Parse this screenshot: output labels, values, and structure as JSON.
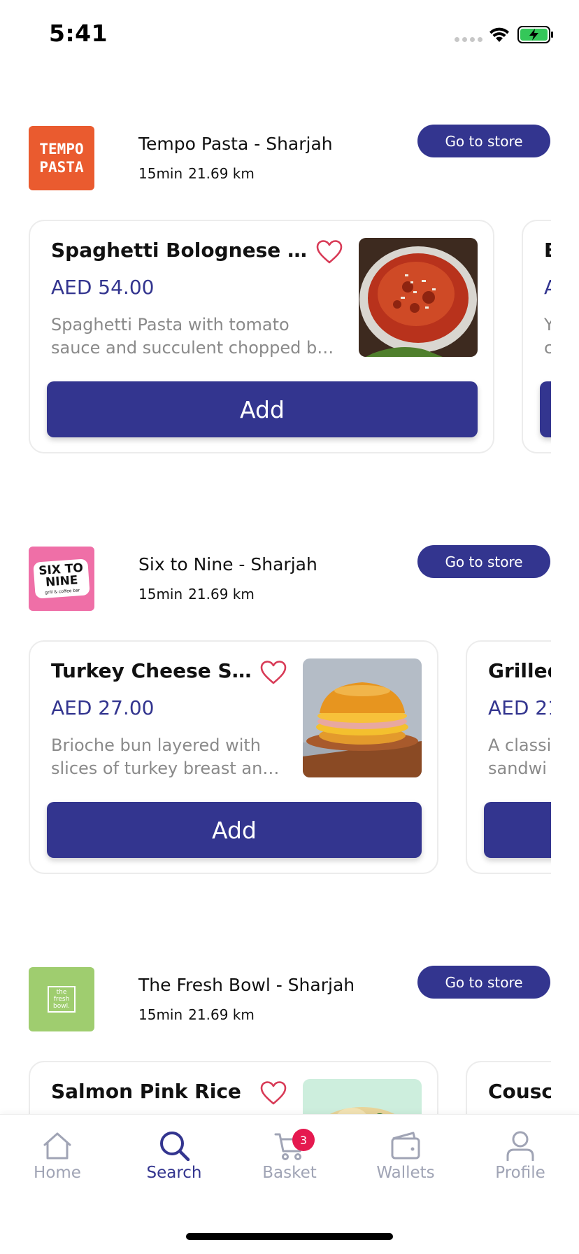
{
  "status": {
    "time": "5:41"
  },
  "stores": [
    {
      "logo_text": [
        "TEMPO",
        "PASTA"
      ],
      "name": "Tempo Pasta - Sharjah",
      "time": "15min",
      "distance": "21.69 km",
      "go_label": "Go to store",
      "products": [
        {
          "name": "Spaghetti Bolognese Pasta",
          "price": "AED 54.00",
          "desc_lines": [
            "Spaghetti Pasta with tomato",
            "sauce and succulent chopped beef"
          ],
          "add_label": "Add"
        },
        {
          "name": "B",
          "price": "A",
          "desc_lines": [
            "Y",
            "c"
          ],
          "add_label": ""
        }
      ]
    },
    {
      "logo_text": [
        "SIX TO",
        "NINE",
        "grill & coffee bar"
      ],
      "name": "Six to Nine - Sharjah",
      "time": "15min",
      "distance": "21.69 km",
      "go_label": "Go to store",
      "products": [
        {
          "name": "Turkey Cheese Sandwich",
          "price": "AED 27.00",
          "desc_lines": [
            "Brioche bun layered with",
            "slices of turkey breast and cheese"
          ],
          "add_label": "Add"
        },
        {
          "name": "Grilled",
          "price": "AED 21.",
          "desc_lines": [
            "A classi",
            "sandwi"
          ],
          "add_label": ""
        }
      ]
    },
    {
      "logo_text": [
        "the",
        "fresh",
        "bowl."
      ],
      "name": "The Fresh Bowl - Sharjah",
      "time": "15min",
      "distance": "21.69 km",
      "go_label": "Go to store",
      "products": [
        {
          "name": "Salmon Pink Rice",
          "price": "",
          "desc_lines": [],
          "add_label": ""
        },
        {
          "name": "Cousc",
          "price": "",
          "desc_lines": [],
          "add_label": ""
        }
      ]
    }
  ],
  "tabs": [
    {
      "label": "Home",
      "icon": "home-icon",
      "active": false
    },
    {
      "label": "Search",
      "icon": "search-icon",
      "active": true
    },
    {
      "label": "Basket",
      "icon": "cart-icon",
      "active": false,
      "badge": "3"
    },
    {
      "label": "Wallets",
      "icon": "wallet-icon",
      "active": false
    },
    {
      "label": "Profile",
      "icon": "profile-icon",
      "active": false
    }
  ],
  "colors": {
    "primary": "#33358f",
    "badge": "#e5194f",
    "heart": "#d83a56",
    "tab_inactive": "#a0a4b5"
  }
}
